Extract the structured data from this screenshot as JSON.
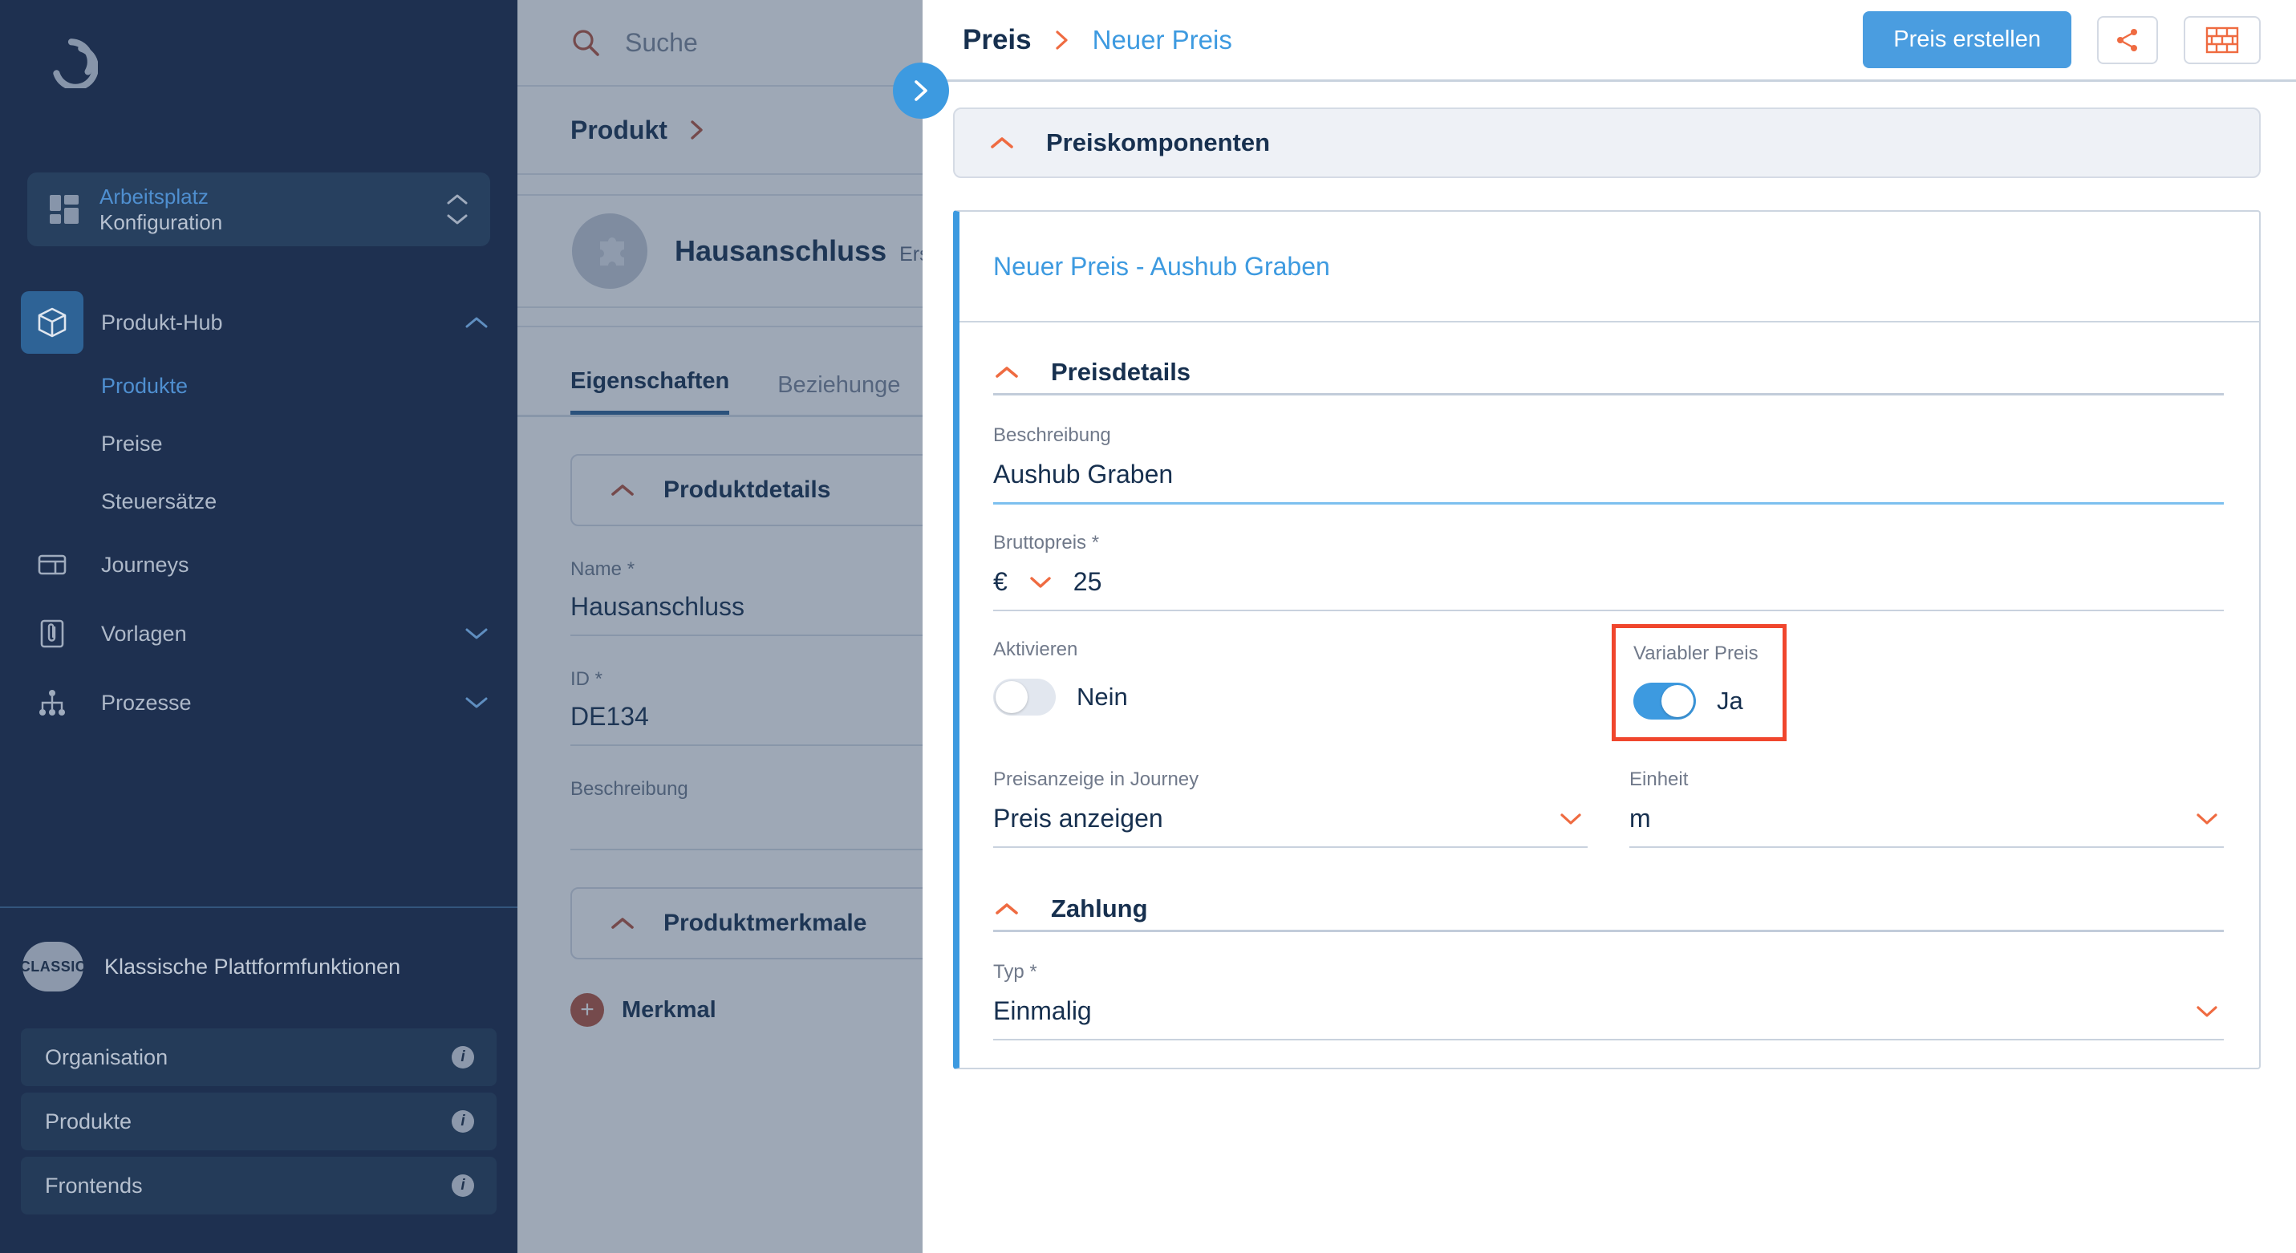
{
  "colors": {
    "sidebar_bg": "#1e3050",
    "accent_blue": "#3d9ae0",
    "accent_orange": "#ef6b41",
    "highlight_red": "#f0462d",
    "text_dark": "#17304f"
  },
  "sidebar": {
    "logo_name": "app-logo",
    "workspace": {
      "top_label": "Arbeitsplatz",
      "bottom_label": "Konfiguration"
    },
    "nav": [
      {
        "label": "Produkt-Hub",
        "icon": "cube-icon",
        "active": true,
        "expanded": true
      },
      {
        "label": "Journeys",
        "icon": "journey-icon",
        "active": false,
        "expanded": null
      },
      {
        "label": "Vorlagen",
        "icon": "template-icon",
        "active": false,
        "expanded": false
      },
      {
        "label": "Prozesse",
        "icon": "process-icon",
        "active": false,
        "expanded": false
      }
    ],
    "sub_items": [
      {
        "label": "Produkte",
        "active": true
      },
      {
        "label": "Preise",
        "active": false
      },
      {
        "label": "Steuersätze",
        "active": false
      }
    ],
    "classic": {
      "badge": "CLASSIC",
      "title": "Klassische Plattformfunktionen",
      "items": [
        {
          "label": "Organisation"
        },
        {
          "label": "Produkte"
        },
        {
          "label": "Frontends"
        }
      ]
    }
  },
  "middle": {
    "search_placeholder": "Suche",
    "breadcrumb": "Produkt",
    "record_title": "Hausanschluss",
    "record_sub": "Ers",
    "tabs": [
      {
        "label": "Eigenschaften",
        "active": true
      },
      {
        "label": "Beziehunge",
        "active": false
      }
    ],
    "section_productdetails": "Produktdetails",
    "fields": [
      {
        "label": "Name *",
        "value": "Hausanschluss"
      },
      {
        "label": "ID *",
        "value": "DE134"
      },
      {
        "label": "Beschreibung",
        "value": ""
      }
    ],
    "section_merkmale": "Produktmerkmale",
    "add_label": "Merkmal"
  },
  "right": {
    "breadcrumb_root": "Preis",
    "breadcrumb_current": "Neuer Preis",
    "create_button": "Preis erstellen",
    "share_icon": "share-icon",
    "wall_icon": "brick-wall-icon",
    "section_components": "Preiskomponenten",
    "component_title": "Neuer Preis - Aushub Graben",
    "section_pricedetails": "Preisdetails",
    "description_label": "Beschreibung",
    "description_value": "Aushub Graben",
    "gross_label": "Bruttopreis *",
    "currency_symbol": "€",
    "gross_value": "25",
    "activate_label": "Aktivieren",
    "activate_state": "Nein",
    "variable_label": "Variabler Preis",
    "variable_state": "Ja",
    "journey_label": "Preisanzeige in Journey",
    "journey_value": "Preis anzeigen",
    "unit_label": "Einheit",
    "unit_value": "m",
    "section_payment": "Zahlung",
    "type_label": "Typ *",
    "type_value": "Einmalig"
  }
}
